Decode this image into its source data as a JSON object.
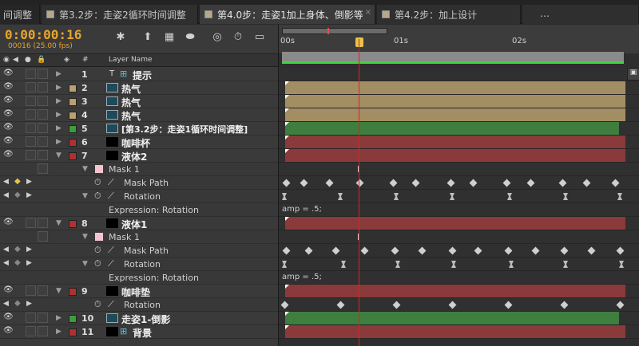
{
  "tabs": [
    {
      "label": "间调整",
      "active": false
    },
    {
      "label": "第3.2步：走姿2循环时间调整",
      "active": false
    },
    {
      "label": "第4.0步：走姿1加上身体、倒影等",
      "active": true
    },
    {
      "label": "第4.2步：加上设计"
    },
    {
      "label": "…"
    }
  ],
  "timecode": "0:00:00:16",
  "fps_label": "00016 (25.00 fps)",
  "column_headers": {
    "num": "#",
    "layer_name": "Layer Name"
  },
  "ruler": {
    "t0": "00s",
    "t1": "01s",
    "t2": "02s"
  },
  "layers": [
    {
      "num": "1",
      "name": "提示",
      "color": "#3a3a3a",
      "kind": "text"
    },
    {
      "num": "2",
      "name": "热气",
      "color": "#b8a070",
      "kind": "comp"
    },
    {
      "num": "3",
      "name": "热气",
      "color": "#b8a070",
      "kind": "comp"
    },
    {
      "num": "4",
      "name": "热气",
      "color": "#b8a070",
      "kind": "comp"
    },
    {
      "num": "5",
      "name": "[第3.2步：走姿1循环时间调整]",
      "color": "#3a9e3a",
      "kind": "comp"
    },
    {
      "num": "6",
      "name": "咖啡杯",
      "color": "#b03030",
      "kind": "solid"
    },
    {
      "num": "7",
      "name": "液体2",
      "color": "#b03030",
      "kind": "solid"
    },
    {
      "num": "8",
      "name": "液体1",
      "color": "#b03030",
      "kind": "solid"
    },
    {
      "num": "9",
      "name": "咖啡垫",
      "color": "#b03030",
      "kind": "solid"
    },
    {
      "num": "10",
      "name": "走姿1-倒影",
      "color": "#3a9e3a",
      "kind": "comp"
    },
    {
      "num": "11",
      "name": "背景",
      "color": "#b03030",
      "kind": "solid"
    }
  ],
  "sub": {
    "mask1": "Mask 1",
    "mask_path": "Mask Path",
    "rotation": "Rotation",
    "expr_label": "Expression: Rotation",
    "expr_value": "amp = .5;"
  }
}
